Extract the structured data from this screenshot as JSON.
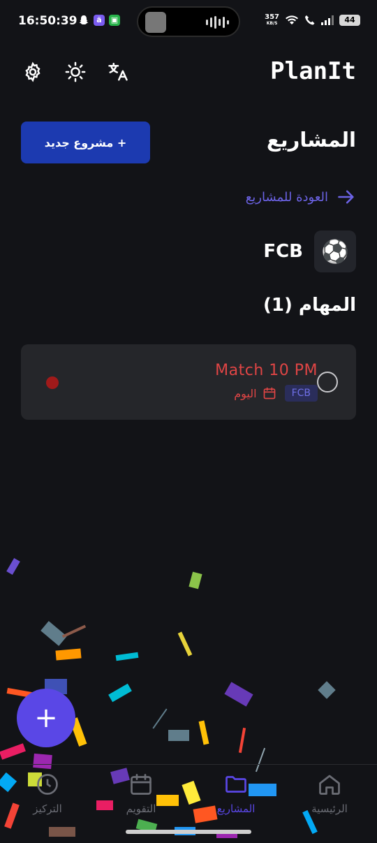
{
  "status_bar": {
    "time": "16:50:39",
    "speed_value": "357",
    "speed_unit": "KB/S",
    "battery": "44"
  },
  "header": {
    "app_name": "PlanIt",
    "icons": [
      "settings-icon",
      "sun-icon",
      "translate-icon"
    ]
  },
  "section": {
    "title": "المشاريع",
    "new_project_button": "+ مشروع جديد"
  },
  "back_link": "العودة للمشاريع",
  "project": {
    "name": "FCB",
    "icon": "⚽"
  },
  "tasks": {
    "heading": "المهام (1)",
    "items": [
      {
        "title": "Match 10 PM",
        "tag": "FCB",
        "date": "اليوم"
      }
    ]
  },
  "fab_label": "+",
  "bottom_nav": {
    "items": [
      {
        "label": "الرئيسية",
        "icon": "home-icon"
      },
      {
        "label": "المشاريع",
        "icon": "folder-icon"
      },
      {
        "label": "التقويم",
        "icon": "calendar-icon"
      },
      {
        "label": "التركيز",
        "icon": "focus-icon"
      }
    ]
  },
  "colors": {
    "background": "#121317",
    "accent": "#5a47e6",
    "primary_button": "#1c3ab0",
    "task_red": "#e04545",
    "card": "#25262a"
  }
}
